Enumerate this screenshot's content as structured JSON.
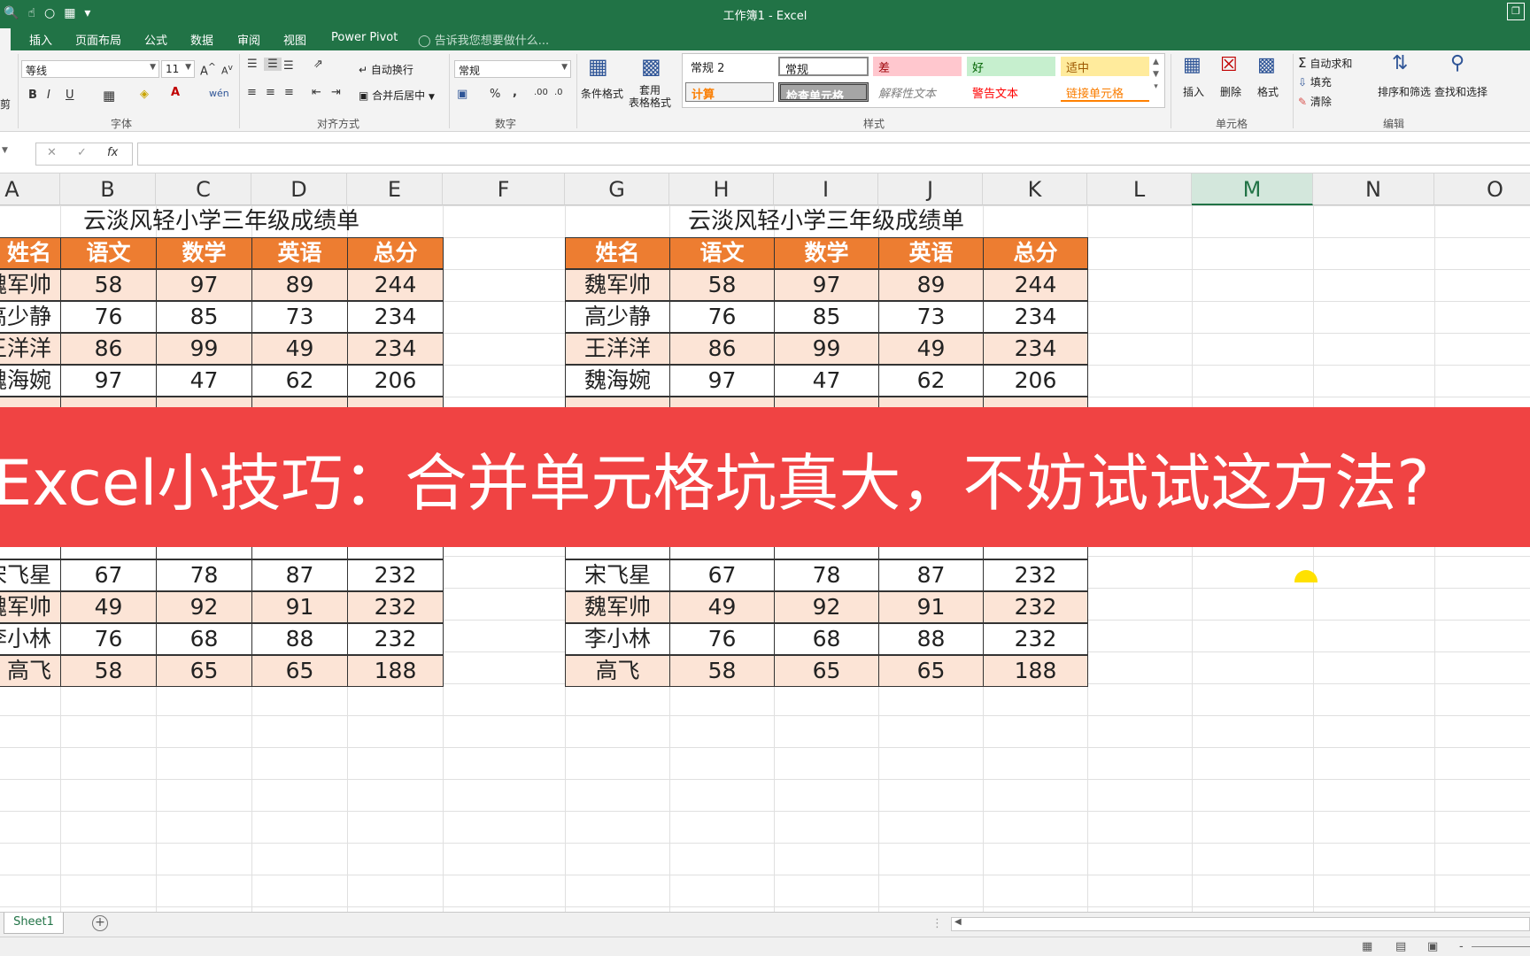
{
  "window": {
    "title": "工作簿1 - Excel"
  },
  "tabs": [
    {
      "label": ""
    },
    {
      "label": "插入"
    },
    {
      "label": "页面布局"
    },
    {
      "label": "公式"
    },
    {
      "label": "数据"
    },
    {
      "label": "审阅"
    },
    {
      "label": "视图"
    },
    {
      "label": "Power Pivot"
    },
    {
      "label": "告诉我您想要做什么..."
    }
  ],
  "ribbon": {
    "font_name": "等线",
    "font_size": "11",
    "number_format": "常规",
    "groups": {
      "font": "字体",
      "alignment": "对齐方式",
      "number": "数字",
      "styles": "样式",
      "cells": "单元格",
      "editing": "编辑"
    },
    "wrap_text": "自动换行",
    "merge_center": "合并后居中",
    "conditional_format": "条件格式",
    "table_format": "套用\n表格格式",
    "styles": [
      {
        "label": "常规 2"
      },
      {
        "label": "常规"
      },
      {
        "label": "差"
      },
      {
        "label": "好"
      },
      {
        "label": "适中"
      },
      {
        "label": "计算"
      },
      {
        "label": "检查单元格"
      },
      {
        "label": "解释性文本"
      },
      {
        "label": "警告文本"
      },
      {
        "label": "链接单元格"
      }
    ],
    "insert": "插入",
    "delete": "删除",
    "format": "格式",
    "autosum": "自动求和",
    "fill": "填充",
    "clear": "清除",
    "sort_filter": "排序和筛选",
    "find_select": "查找和选择",
    "clipboard_fragment": "剪",
    "percent": "%",
    "comma": ","
  },
  "formula_bar": {
    "fx": "fx"
  },
  "columns": [
    "A",
    "B",
    "C",
    "D",
    "E",
    "F",
    "G",
    "H",
    "I",
    "J",
    "K",
    "L",
    "M",
    "N",
    "O"
  ],
  "left_table": {
    "title": "云淡风轻小学三年级成绩单",
    "headers": [
      "姓名",
      "语文",
      "数学",
      "英语",
      "总分"
    ],
    "rows_top": [
      [
        "魏军帅",
        "58",
        "97",
        "89",
        "244"
      ],
      [
        "高少静",
        "76",
        "85",
        "73",
        "234"
      ],
      [
        "王洋洋",
        "86",
        "99",
        "49",
        "234"
      ],
      [
        "魏海婉",
        "97",
        "47",
        "62",
        "206"
      ]
    ],
    "rows_bottom": [
      [
        "宋飞星",
        "67",
        "78",
        "87",
        "232"
      ],
      [
        "魏军帅",
        "49",
        "92",
        "91",
        "232"
      ],
      [
        "李小林",
        "76",
        "68",
        "88",
        "232"
      ],
      [
        "高飞",
        "58",
        "65",
        "65",
        "188"
      ]
    ]
  },
  "right_table": {
    "title": "云淡风轻小学三年级成绩单",
    "headers": [
      "姓名",
      "语文",
      "数学",
      "英语",
      "总分"
    ],
    "rows_top": [
      [
        "魏军帅",
        "58",
        "97",
        "89",
        "244"
      ],
      [
        "高少静",
        "76",
        "85",
        "73",
        "234"
      ],
      [
        "王洋洋",
        "86",
        "99",
        "49",
        "234"
      ],
      [
        "魏海婉",
        "97",
        "47",
        "62",
        "206"
      ]
    ],
    "rows_bottom": [
      [
        "宋飞星",
        "67",
        "78",
        "87",
        "232"
      ],
      [
        "魏军帅",
        "49",
        "92",
        "91",
        "232"
      ],
      [
        "李小林",
        "76",
        "68",
        "88",
        "232"
      ],
      [
        "高飞",
        "58",
        "65",
        "65",
        "188"
      ]
    ]
  },
  "banner": {
    "text": "Excel小技巧：合并单元格坑真大，不妨试试这方法?"
  },
  "sheets": [
    {
      "label": "Sheet1"
    }
  ],
  "colors": {
    "excel_green": "#217346",
    "header_orange": "#ed7d31",
    "row_pink": "#fce4d6",
    "banner_red": "#f04343"
  }
}
